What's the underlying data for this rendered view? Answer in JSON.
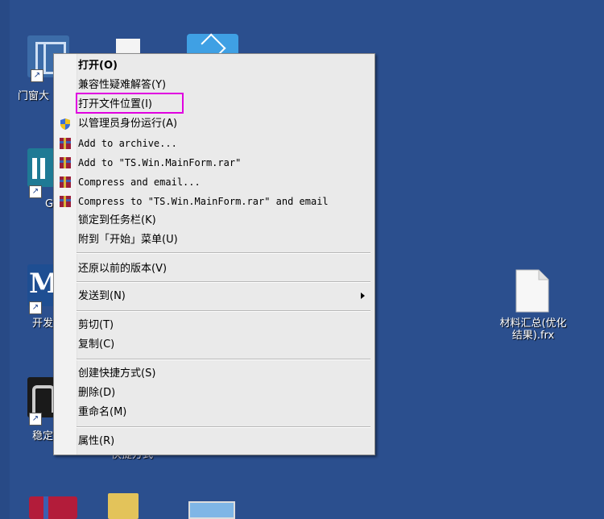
{
  "desktop": {
    "icons": {
      "menjiang_label": "门窗大",
      "g_label": "G",
      "kaifa_label": "开发",
      "wending_label": "稳定",
      "behind_label": "快捷方式",
      "file_label": "材料汇总(优化结果).frx"
    }
  },
  "context_menu": {
    "items": [
      {
        "label": "打开(O)",
        "bold": true
      },
      {
        "label": "兼容性疑难解答(Y)"
      },
      {
        "label": "打开文件位置(I)",
        "highlighted": true
      },
      {
        "label": "以管理员身份运行(A)",
        "icon": "uac-shield-icon"
      },
      {
        "label": "Add to archive...",
        "icon": "winrar-icon"
      },
      {
        "label": "Add to \"TS.Win.MainForm.rar\"",
        "icon": "winrar-icon"
      },
      {
        "label": "Compress and email...",
        "icon": "winrar-icon"
      },
      {
        "label": "Compress to \"TS.Win.MainForm.rar\" and email",
        "icon": "winrar-icon"
      },
      {
        "label": "锁定到任务栏(K)"
      },
      {
        "label": "附到「开始」菜单(U)"
      },
      {
        "label": "还原以前的版本(V)"
      },
      {
        "label": "发送到(N)",
        "submenu": true
      },
      {
        "label": "剪切(T)"
      },
      {
        "label": "复制(C)"
      },
      {
        "label": "创建快捷方式(S)"
      },
      {
        "label": "删除(D)"
      },
      {
        "label": "重命名(M)"
      },
      {
        "label": "属性(R)"
      }
    ]
  },
  "colors": {
    "desktop_bg": "#2b4f8e",
    "menu_bg": "#eaeaea",
    "highlight_border": "#e000e0"
  }
}
